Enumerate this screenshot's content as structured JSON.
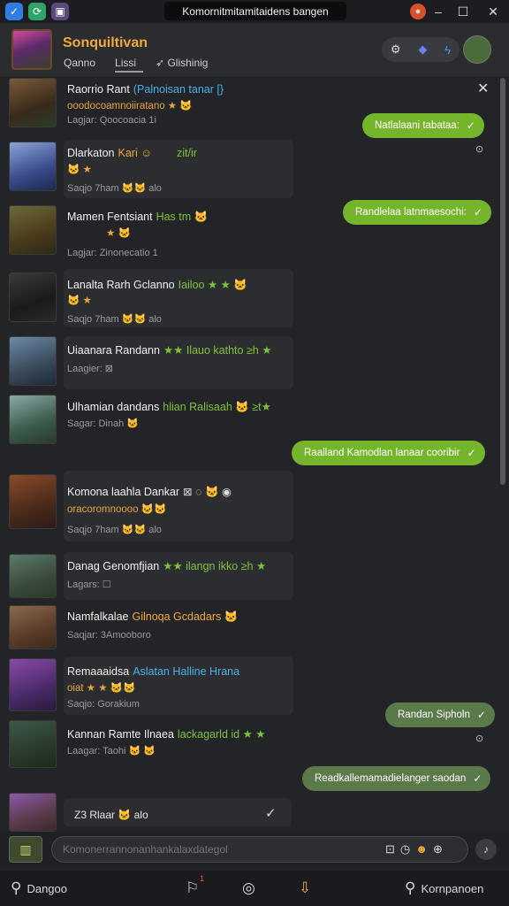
{
  "window": {
    "title": "Komornitmitamitaidens bangen",
    "app_icons": [
      "chevron-icon",
      "refresh-icon",
      "bookmark-icon"
    ]
  },
  "header": {
    "name": "Sonquiltivan",
    "tabs": [
      "Qanno",
      "Lissi",
      "Glishinig"
    ]
  },
  "messages_left": [
    {
      "name": "Raorrio Rant",
      "tag": "(Palnoisan tanar [}",
      "line2": "ooodocoamnoiiratano ★ 🐱",
      "line3": "Lagjar: Qoocoacia 1i"
    },
    {
      "name": "Dlarkaton",
      "tag": "Kari ☺",
      "tag2": "zit/ir",
      "line2": "🐱 ★",
      "line3": "Saqjo 7ham 🐱🐱 alo"
    },
    {
      "name": "Mamen Fentsiant",
      "tag": "Has tm 🐱",
      "line2": "★ 🐱",
      "line3": "Lagjar: Zinonecatio 1"
    },
    {
      "name": "Lanalta Rarh Gclanno",
      "tag": "Iailoo ★ ★ 🐱",
      "line2": "🐱 ★",
      "line3": "Saqjo 7ham 🐱🐱 alo"
    },
    {
      "name": "Uiaanara Randann",
      "tag": "★★ Ilauo kathto ≥h ★",
      "line2": "",
      "line3": "Laagier: ⊠"
    },
    {
      "name": "Ulhamian dandans",
      "tag": "hlian Ralisaah 🐱 ≥t★",
      "line2": "",
      "line3": "Sagar: Dinah 🐱"
    },
    {
      "name": "Komona laahla Dankar",
      "tag": "⊠ ◌ 🐱 ◉",
      "line2": "oracoromnoooo 🐱🐱",
      "line3": "Saqjo 7ham 🐱🐱 alo"
    },
    {
      "name": "Danag Genomfjian",
      "tag": "★★ ilangn ikko ≥h ★",
      "line2": "",
      "line3": "Lagars: ☐"
    },
    {
      "name": "Namfalkalae",
      "tag": "Gilnoqa Gcdadars 🐱",
      "line2": "",
      "line3": "Saqjar: 3Amooboro"
    },
    {
      "name": "Remaaaidsa",
      "tag": "Aslatan Halline Hrana",
      "line2": "oiat ★ ★ 🐱🐱",
      "line3": "Saqjo: Gorakium"
    },
    {
      "name": "Kannan Ramte Ilnaea",
      "tag": "lackagarld id ★ ★",
      "line2": "",
      "line3": "Laagar: Taohi 🐱 🐱"
    }
  ],
  "messages_right": [
    {
      "text": "Natlalaani tabataa:"
    },
    {
      "text": "Randlelaa latnmaesochi:"
    },
    {
      "text": "Raalland Kamodlan lanaar cooribir"
    },
    {
      "text": "Randan Sipholn"
    },
    {
      "text": "Readkallemamadielanger saodan"
    }
  ],
  "last_message": {
    "text": "Z3 Rlaar 🐱 alo"
  },
  "composer": {
    "placeholder": "Komonerrannonanhankalaxdategol"
  },
  "bottom_nav": {
    "left_label": "Dangoo",
    "right_label": "Kornpanoen",
    "badge": "1"
  },
  "colors": {
    "accent_green": "#75b52b",
    "name_orange": "#f2a93b",
    "tag_green": "#7ec23a",
    "tag_blue": "#4ab0e8"
  }
}
